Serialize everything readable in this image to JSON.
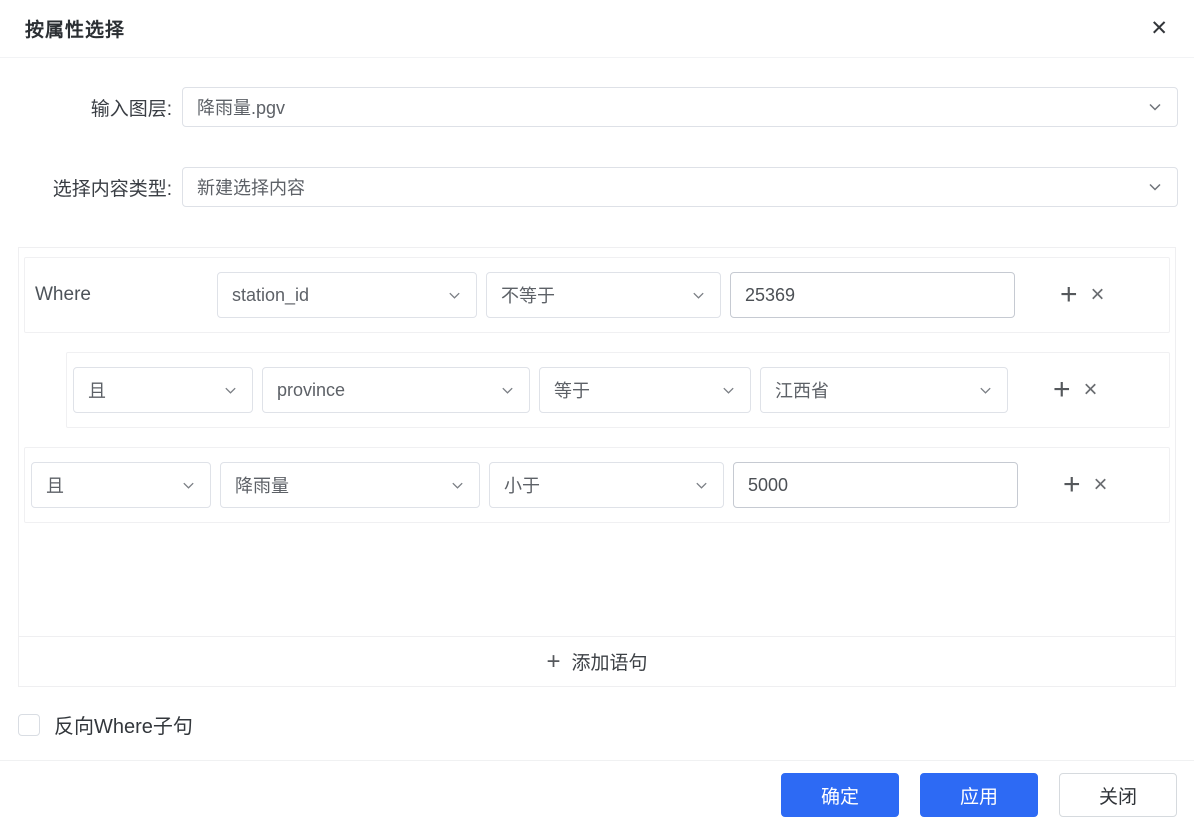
{
  "dialog": {
    "title": "按属性选择",
    "close_icon": "✕"
  },
  "form": {
    "input_layer": {
      "label": "输入图层:",
      "value": "降雨量.pgv"
    },
    "selection_type": {
      "label": "选择内容类型:",
      "value": "新建选择内容"
    }
  },
  "where_builder": {
    "rows": [
      {
        "prefix": "Where",
        "field": "station_id",
        "operator": "不等于",
        "value": "25369"
      },
      {
        "prefix": "且",
        "field": "province",
        "operator": "等于",
        "value": "江西省"
      },
      {
        "prefix": "且",
        "field": "降雨量",
        "operator": "小于",
        "value": "5000"
      }
    ],
    "add_icon": "+",
    "remove_icon": "×",
    "add_statement": {
      "plus": "+",
      "label": "添加语句"
    }
  },
  "options": {
    "invert_label": "反向Where子句",
    "invert_checked": false
  },
  "footer": {
    "ok_label": "确定",
    "apply_label": "应用",
    "close_label": "关闭"
  },
  "colors": {
    "accent_blue": "#2d6af4",
    "border_light": "#efeff1",
    "control_border": "#dfe2e8"
  }
}
